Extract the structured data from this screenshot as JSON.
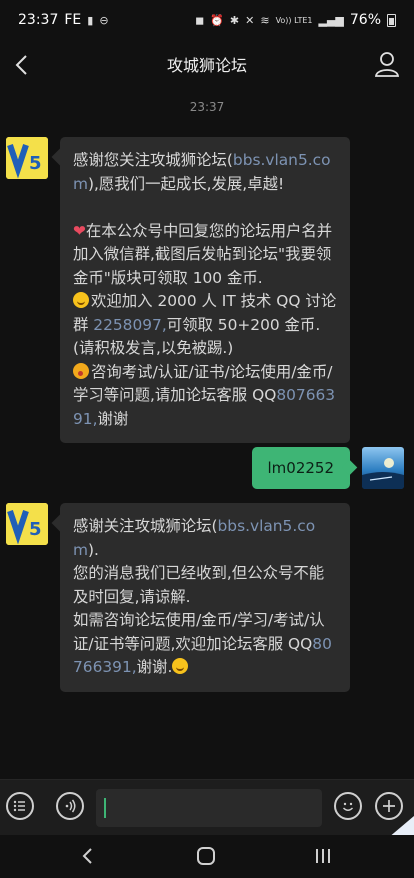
{
  "status_bar": {
    "time": "23:37",
    "left_extra": "FE",
    "battery": "76%",
    "network": "Vo)) LTE1"
  },
  "header": {
    "title": "攻城狮论坛"
  },
  "chat": {
    "timestamp": "23:37",
    "msg1": {
      "p1_a": "感谢您关注攻城狮论坛(",
      "p1_link": "bbs.vlan5.com",
      "p1_b": "),愿我们一起成长,发展,卓越!",
      "p2": "在本公众号中回复您的论坛用户名并加入微信群,截图后发帖到论坛\"我要领金币\"版块可领取 100 金币.",
      "p3_a": "欢迎加入 2000 人 IT 技术 QQ 讨论群 ",
      "p3_link": "2258097,",
      "p3_b": "可领取 50+200 金币.(请积极发言,以免被踢.)",
      "p4_a": "咨询考试/认证/证书/论坛使用/金币/学习等问题,请加论坛客服 QQ",
      "p4_link": "80766391,",
      "p4_b": "谢谢"
    },
    "outgoing": "lm02252",
    "msg2": {
      "l1_a": "感谢关注攻城狮论坛(",
      "l1_link": "bbs.vlan5.com",
      "l1_b": ").",
      "l2": "您的消息我们已经收到,但公众号不能及时回复,请谅解.",
      "l3_a": "如需咨询论坛使用/金币/学习/考试/认证/证书等问题,欢迎加论坛客服 QQ",
      "l3_link": "80766391,",
      "l3_b": "谢谢."
    }
  },
  "avatar_logo": "V5",
  "input": {
    "placeholder": ""
  },
  "icons": [
    "back-arrow-icon",
    "profile-icon",
    "list-icon",
    "voice-icon",
    "emoji-icon",
    "plus-icon",
    "nav-back-icon",
    "nav-home-icon",
    "nav-recent-icon"
  ]
}
